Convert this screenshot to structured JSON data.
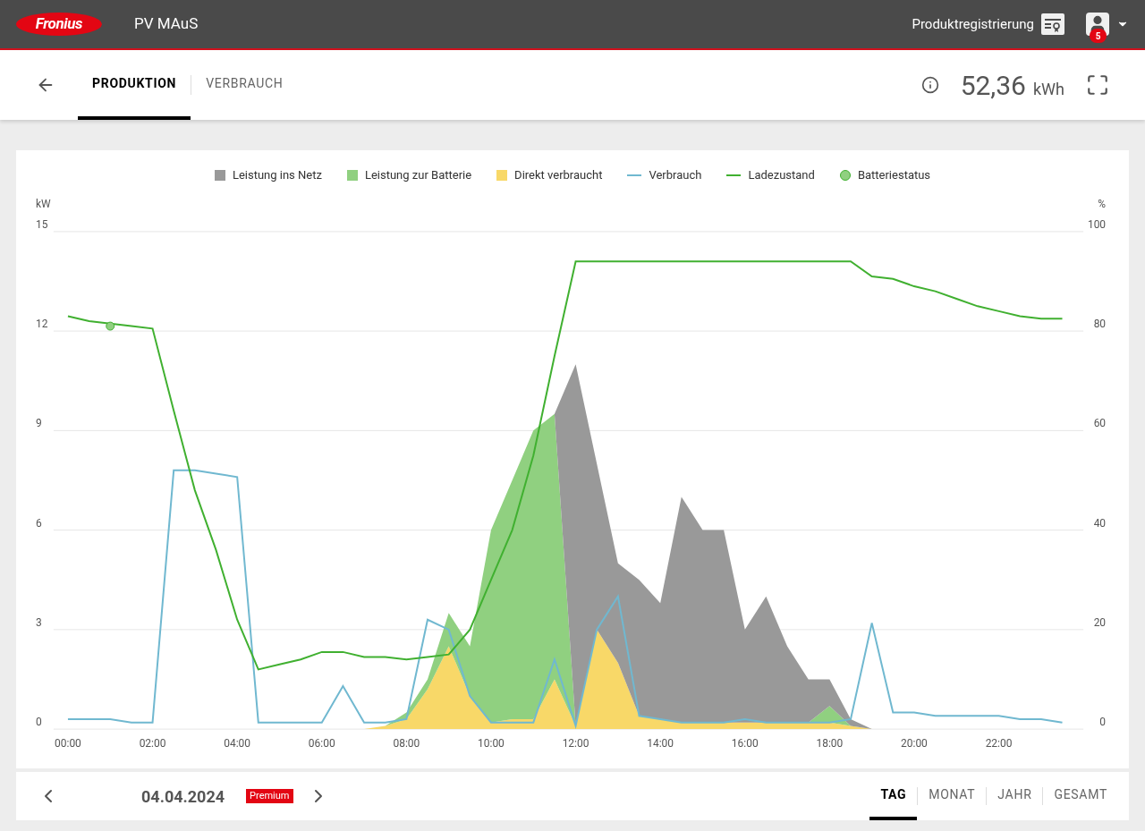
{
  "header": {
    "logo": "Fronius",
    "title": "PV MAuS",
    "registration": "Produktregistrierung",
    "badge": "5"
  },
  "tabs": [
    {
      "label": "PRODUKTION",
      "selected": true
    },
    {
      "label": "VERBRAUCH",
      "selected": false
    }
  ],
  "total": {
    "value": "52,36",
    "unit": "kWh"
  },
  "chart": {
    "chart_data": {
      "type": "area",
      "stacked": true,
      "ylabel": "kW",
      "y2label": "%",
      "ylim": [
        0,
        15
      ],
      "y2lim": [
        0,
        100
      ],
      "yticks": [
        0,
        3,
        6,
        9,
        12,
        15
      ],
      "y2ticks": [
        0,
        20,
        40,
        60,
        80,
        100
      ],
      "xlim": [
        -0.34,
        24
      ],
      "grid": true,
      "xticks": [
        {
          "value": 0,
          "label": "00:00"
        },
        {
          "value": 2,
          "label": "02:00"
        },
        {
          "value": 4,
          "label": "04:00"
        },
        {
          "value": 6,
          "label": "06:00"
        },
        {
          "value": 8,
          "label": "08:00"
        },
        {
          "value": 10,
          "label": "10:00"
        },
        {
          "value": 12,
          "label": "12:00"
        },
        {
          "value": 14,
          "label": "14:00"
        },
        {
          "value": 16,
          "label": "16:00"
        },
        {
          "value": 18,
          "label": "18:00"
        },
        {
          "value": 20,
          "label": "20:00"
        },
        {
          "value": 22,
          "label": "22:00"
        }
      ],
      "x": [
        0,
        0.5,
        1,
        1.5,
        2,
        2.5,
        3,
        3.5,
        4,
        4.5,
        5,
        5.5,
        6,
        6.5,
        7,
        7.5,
        8,
        8.5,
        9,
        9.5,
        10,
        10.5,
        11,
        11.5,
        12,
        12.5,
        13,
        13.5,
        14,
        14.5,
        15,
        15.5,
        16,
        16.5,
        17,
        17.5,
        18,
        18.5,
        19,
        19.5,
        20,
        20.5,
        21,
        21.5,
        22,
        22.5,
        23,
        23.5
      ],
      "series": [
        {
          "name": "Leistung ins Netz",
          "type": "area",
          "color": "#999999",
          "values": [
            0,
            0,
            0,
            0,
            0,
            0,
            0,
            0,
            0,
            0,
            0,
            0,
            0,
            0,
            0,
            0,
            0,
            0,
            0,
            0,
            0,
            0,
            0,
            0,
            10.9,
            5,
            3,
            4.1,
            3.5,
            6.8,
            5.8,
            5.8,
            2.8,
            3.8,
            2.3,
            1.3,
            0.8,
            0.2,
            0,
            0,
            0,
            0,
            0,
            0,
            0,
            0,
            0,
            0
          ]
        },
        {
          "name": "Leistung zur Batterie",
          "type": "area",
          "color": "#90d080",
          "values": [
            0,
            0,
            0,
            0,
            0,
            0,
            0,
            0,
            0,
            0,
            0,
            0,
            0,
            0,
            0,
            0,
            0.2,
            0.3,
            1,
            1.5,
            5.8,
            7.2,
            8.7,
            8,
            0,
            0,
            0,
            0,
            0,
            0,
            0,
            0,
            0,
            0,
            0,
            0,
            0.5,
            0,
            0,
            0,
            0,
            0,
            0,
            0,
            0,
            0,
            0,
            0
          ]
        },
        {
          "name": "Direkt verbraucht",
          "type": "area",
          "color": "#f8d868",
          "values": [
            0,
            0,
            0,
            0,
            0,
            0,
            0,
            0,
            0,
            0,
            0,
            0,
            0,
            0,
            0,
            0.1,
            0.3,
            1.2,
            2.5,
            1,
            0.2,
            0.3,
            0.3,
            1.5,
            0.1,
            3,
            2,
            0.4,
            0.3,
            0.2,
            0.2,
            0.2,
            0.2,
            0.2,
            0.2,
            0.2,
            0.2,
            0.1,
            0,
            0,
            0,
            0,
            0,
            0,
            0,
            0,
            0,
            0
          ]
        },
        {
          "name": "Verbrauch",
          "type": "line",
          "color": "#70b8d0",
          "values": [
            0.3,
            0.3,
            0.3,
            0.2,
            0.2,
            7.8,
            7.8,
            7.7,
            7.6,
            0.2,
            0.2,
            0.2,
            0.2,
            1.3,
            0.2,
            0.2,
            0.3,
            3.3,
            3,
            1,
            0.2,
            0.2,
            0.2,
            2.1,
            0.1,
            3,
            4,
            0.4,
            0.3,
            0.2,
            0.2,
            0.2,
            0.3,
            0.2,
            0.2,
            0.2,
            0.2,
            0.3,
            3.2,
            0.5,
            0.5,
            0.4,
            0.4,
            0.4,
            0.4,
            0.3,
            0.3,
            0.2
          ]
        },
        {
          "name": "Ladezustand",
          "type": "line",
          "axis": "y2",
          "color": "#40b030",
          "values": [
            83,
            82,
            81.5,
            81,
            80.5,
            64,
            48,
            36,
            22,
            12,
            13,
            14,
            15.5,
            15.5,
            14.5,
            14.5,
            14,
            14.5,
            15,
            20,
            30,
            40,
            55,
            75,
            94,
            94,
            94,
            94,
            94,
            94,
            94,
            94,
            94,
            94,
            94,
            94,
            94,
            94,
            91,
            90.5,
            89,
            88,
            86.5,
            85,
            84,
            83,
            82.5,
            82.5
          ]
        },
        {
          "name": "Batteriestatus",
          "type": "scatter",
          "axis": "y2",
          "color": "#90d080",
          "values": [
            null,
            null,
            81,
            null,
            null,
            null,
            null,
            null,
            null,
            null,
            null,
            null,
            null,
            null,
            null,
            null,
            null,
            null,
            null,
            null,
            null,
            null,
            null,
            null,
            null,
            null,
            null,
            null,
            null,
            null,
            null,
            null,
            null,
            null,
            null,
            null,
            null,
            null,
            null,
            null,
            null,
            null,
            null,
            null,
            null,
            null,
            null,
            null
          ]
        }
      ]
    }
  },
  "footer": {
    "date": "04.04.2024",
    "badge": "Premium",
    "periods": [
      {
        "label": "TAG",
        "selected": true
      },
      {
        "label": "MONAT",
        "selected": false
      },
      {
        "label": "JAHR",
        "selected": false
      },
      {
        "label": "GESAMT",
        "selected": false
      }
    ]
  }
}
